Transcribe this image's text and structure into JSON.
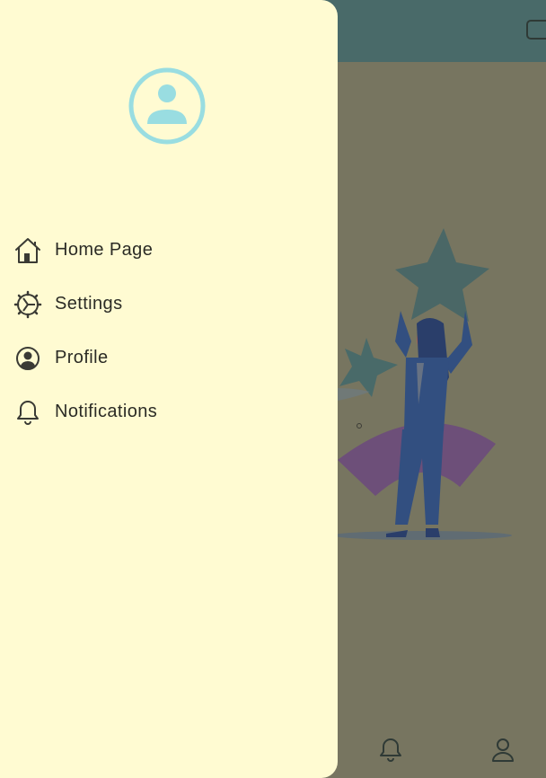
{
  "colors": {
    "drawer_bg": "#fffbd2",
    "scrim_bg": "#777560",
    "app_bar": "#496a69",
    "avatar_accent": "#99dde1",
    "icon_color": "#3a3a34",
    "hero_star": "#496a69",
    "hero_figure": "#324f80",
    "hero_arc": "#6d4f79"
  },
  "drawer": {
    "avatar_icon": "account-circle-icon",
    "menu": [
      {
        "label": "Home Page",
        "icon": "home-icon"
      },
      {
        "label": "Settings",
        "icon": "settings-gear-icon"
      },
      {
        "label": "Profile",
        "icon": "account-circle-outline-icon"
      },
      {
        "label": "Notifications",
        "icon": "bell-icon"
      }
    ]
  },
  "bottom_nav": [
    {
      "icon": "bell-icon"
    },
    {
      "icon": "person-icon"
    }
  ]
}
